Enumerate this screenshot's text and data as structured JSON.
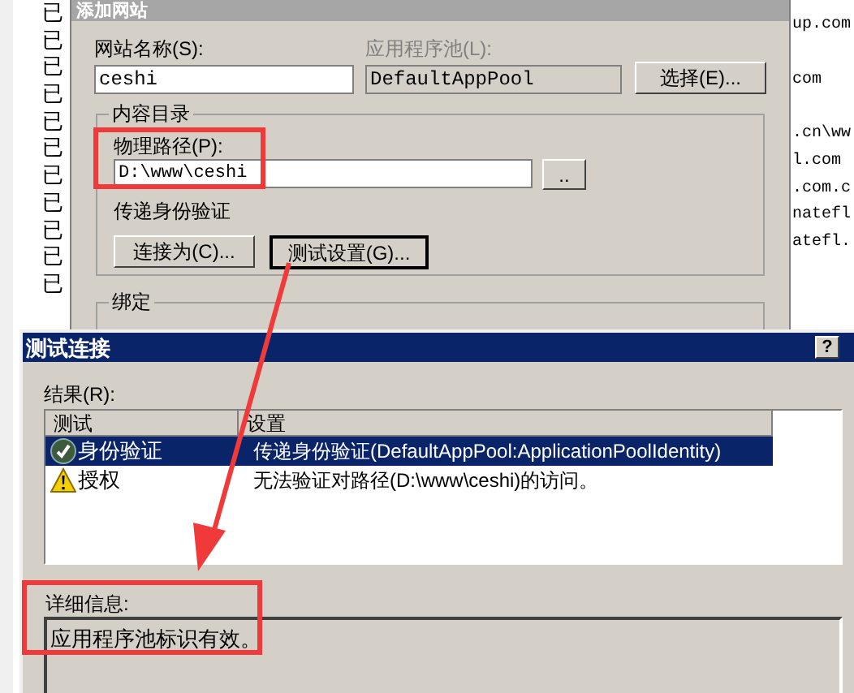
{
  "background_list": {
    "left_items": [
      "已",
      "已",
      "已",
      "已",
      "已",
      "已",
      "已",
      "已",
      "已",
      "已",
      "已"
    ],
    "right_items": [
      "up.com",
      "com",
      ".cn\\ww",
      "l.com",
      ".com.c",
      "natefl",
      "atefl."
    ]
  },
  "add_site_dialog": {
    "title": "添加网站",
    "site_name_label": "网站名称(S):",
    "site_name": "ceshi",
    "app_pool_label": "应用程序池(L):",
    "app_pool": "DefaultAppPool",
    "app_pool_disabled": true,
    "select_button": "选择(E)...",
    "content_group": "内容目录",
    "physical_path_label": "物理路径(P):",
    "physical_path": "D:\\www\\ceshi",
    "browse_button": "..",
    "pass_through_label": "传递身份验证",
    "connect_as_button": "连接为(C)...",
    "test_settings_button": "测试设置(G)...",
    "binding_group": "绑定"
  },
  "test_dialog": {
    "title": "测试连接",
    "help_button": "?",
    "results_label": "结果(R):",
    "columns": [
      "测试",
      "设置"
    ],
    "rows": [
      {
        "kind": "success",
        "test": "身份验证",
        "setting": "传递身份验证(DefaultAppPool:ApplicationPoolIdentity)",
        "selected": true
      },
      {
        "kind": "warning",
        "test": "授权",
        "setting": "无法验证对路径(D:\\www\\ceshi)的访问。",
        "selected": false
      }
    ],
    "details_label": "详细信息:",
    "details": "应用程序池标识有效。"
  }
}
